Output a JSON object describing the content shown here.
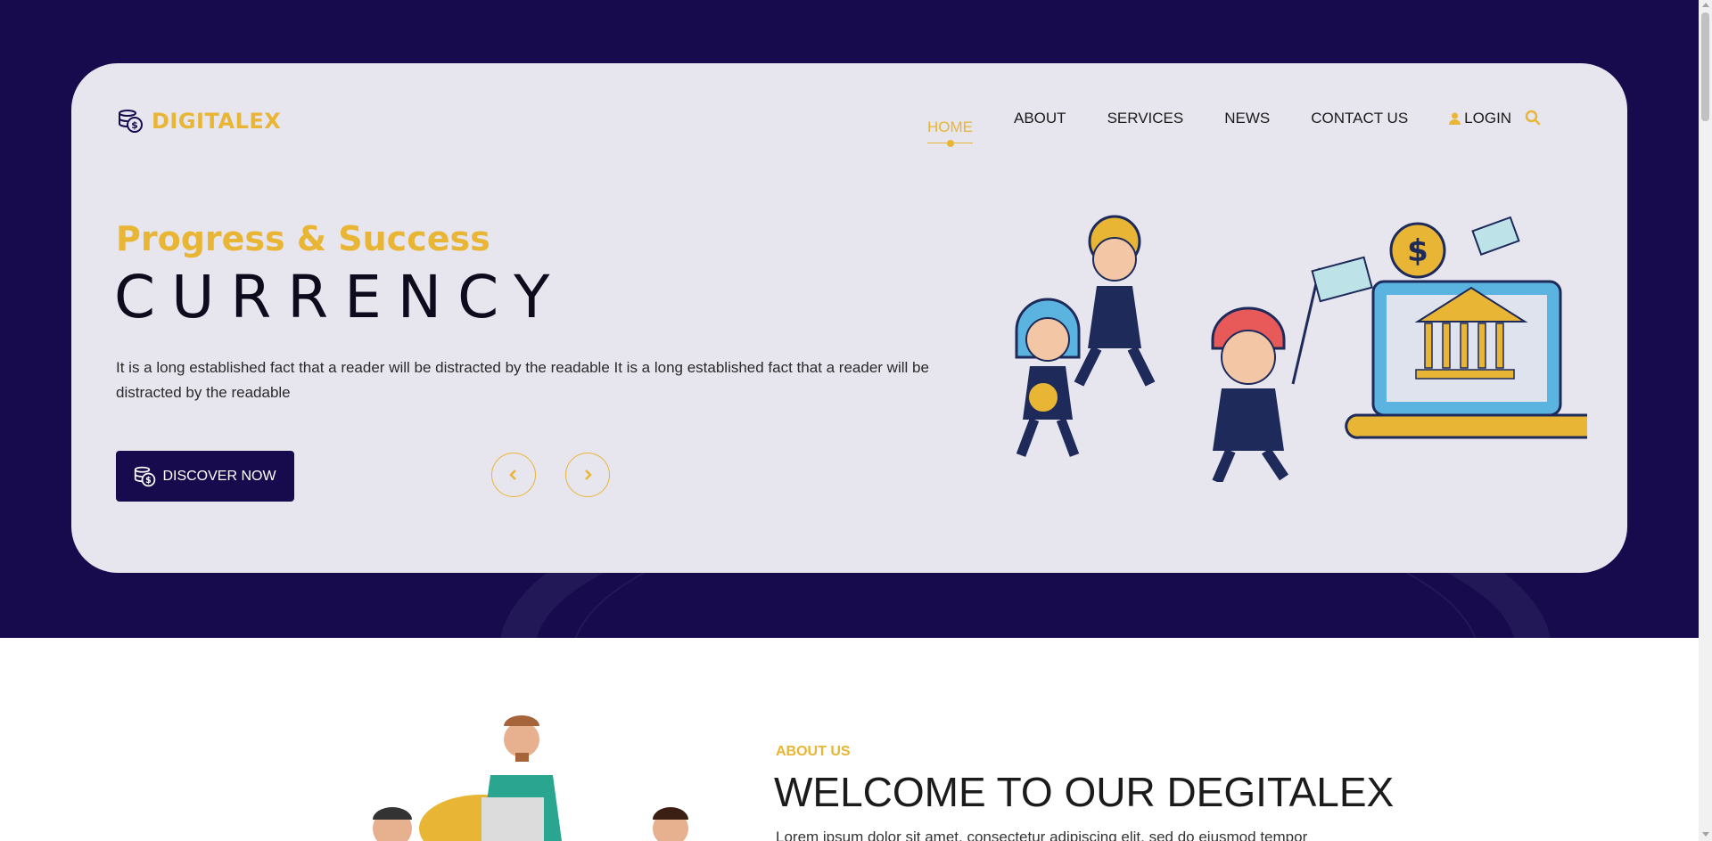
{
  "brand": {
    "name": "DIGITALEX",
    "logo_icon": "coin-stack-icon"
  },
  "nav": {
    "items": [
      {
        "label": "HOME",
        "active": true
      },
      {
        "label": "ABOUT"
      },
      {
        "label": "SERVICES"
      },
      {
        "label": "NEWS"
      },
      {
        "label": "CONTACT US"
      }
    ],
    "login_label": "LOGIN",
    "login_icon": "user-icon",
    "search_icon": "search-icon"
  },
  "hero": {
    "subtitle": "Progress & Success",
    "headline": "CURRENCY",
    "description": "It is a long established fact that a reader will be distracted by the readable It is a long established fact that a reader will be distracted by the readable",
    "cta_label": "DISCOVER NOW",
    "prev_icon": "chevron-left-icon",
    "next_icon": "chevron-right-icon"
  },
  "about": {
    "label": "ABOUT US",
    "title": "WELCOME TO OUR DEGITALEX",
    "text": "Lorem ipsum dolor sit amet, consectetur adipiscing elit, sed do eiusmod tempor"
  },
  "colors": {
    "accent": "#e8b535",
    "navy": "#170b4e",
    "card": "#e7e6ef"
  }
}
